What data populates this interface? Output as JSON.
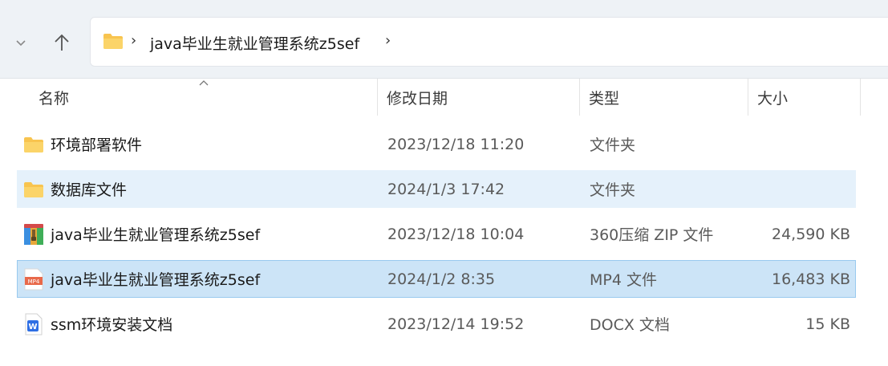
{
  "address": {
    "path": "java毕业生就业管理系统z5sef",
    "chevron": "›"
  },
  "columns": {
    "name": "名称",
    "modified": "修改日期",
    "type": "类型",
    "size": "大小"
  },
  "files": [
    {
      "name": "环境部署软件",
      "modified": "2023/12/18 11:20",
      "type": "文件夹",
      "size": "",
      "icon": "folder-icon",
      "state": "normal"
    },
    {
      "name": "数据库文件",
      "modified": "2024/1/3 17:42",
      "type": "文件夹",
      "size": "",
      "icon": "folder-icon",
      "state": "hover"
    },
    {
      "name": "java毕业生就业管理系统z5sef",
      "modified": "2023/12/18 10:04",
      "type": "360压缩 ZIP 文件",
      "size": "24,590 KB",
      "icon": "zip-archive-icon",
      "state": "normal"
    },
    {
      "name": "java毕业生就业管理系统z5sef",
      "modified": "2024/1/2 8:35",
      "type": "MP4 文件",
      "size": "16,483 KB",
      "icon": "mp4-video-icon",
      "state": "selected"
    },
    {
      "name": "ssm环境安装文档",
      "modified": "2023/12/14 19:52",
      "type": "DOCX 文档",
      "size": "15 KB",
      "icon": "word-document-icon",
      "state": "normal"
    }
  ],
  "icons": {
    "mp4_label": "MP4",
    "docx_label": "W"
  },
  "colors": {
    "folder": "#f8c44f",
    "selected_row": "#cce4f7",
    "hover_row": "#e5f1fb",
    "docx_blue": "#2f6fe4",
    "mp4_orange": "#e8694a"
  }
}
